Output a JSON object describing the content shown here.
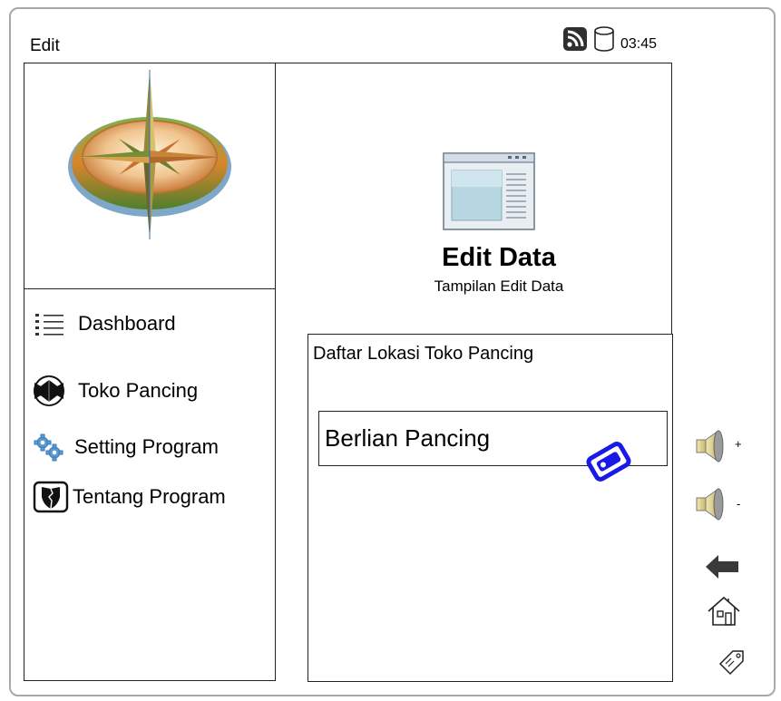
{
  "header": {
    "title": "Edit",
    "clock": "03:45",
    "status_icons": [
      "rss-icon",
      "database-icon"
    ]
  },
  "sidebar": {
    "logo": "compass-rose-logo",
    "items": [
      {
        "label": "Dashboard",
        "icon": "list-icon"
      },
      {
        "label": "Toko Pancing",
        "icon": "bowtie-circle-icon"
      },
      {
        "label": "Setting Program",
        "icon": "gears-icon"
      },
      {
        "label": "Tentang Program",
        "icon": "shield-icon"
      }
    ]
  },
  "main": {
    "hero_icon": "window-document-icon",
    "title": "Edit Data",
    "subtitle": "Tampilan Edit Data"
  },
  "list": {
    "title": "Daftar Lokasi Toko Pancing",
    "items": [
      {
        "label": "Berlian Pancing",
        "action_icon": "edit-icon"
      }
    ]
  },
  "side_controls": {
    "volume_up_sign": "+",
    "volume_down_sign": "-",
    "icons": [
      "volume-up-icon",
      "volume-down-icon",
      "back-arrow-icon",
      "home-icon",
      "tag-icon"
    ]
  },
  "colors": {
    "border": "#222222",
    "device_border": "#a8a8a8",
    "edit_icon": "#1a1ae6"
  }
}
